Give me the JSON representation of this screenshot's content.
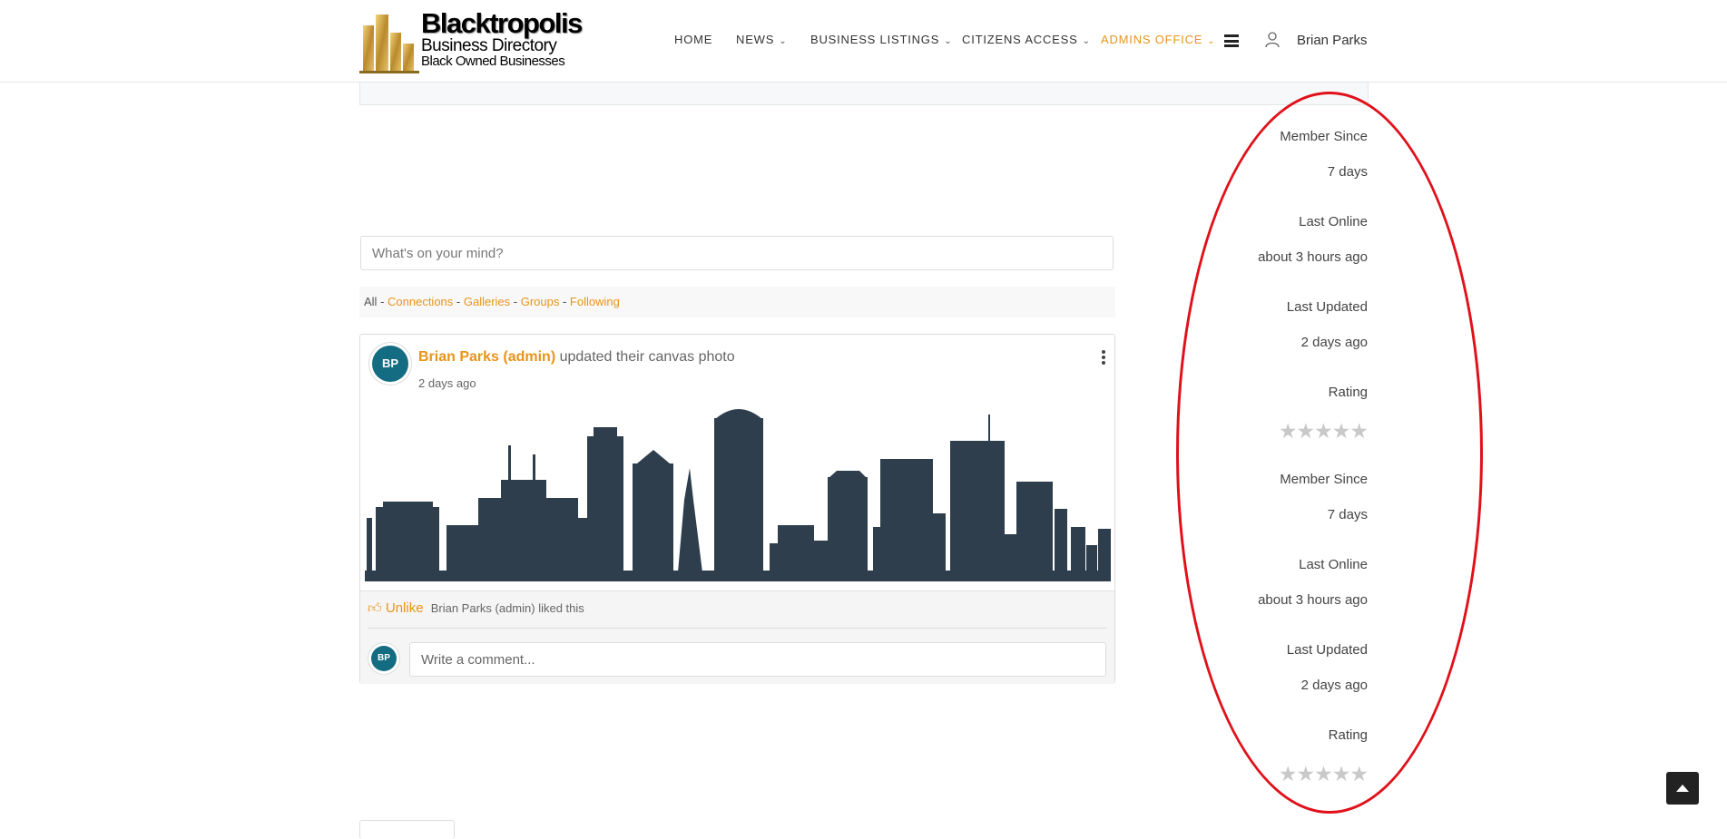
{
  "brand": {
    "title": "Blacktropolis",
    "subtitle1": "Business Directory",
    "subtitle2": "Black Owned Businesses"
  },
  "nav": {
    "items": [
      {
        "label": "HOME"
      },
      {
        "label": "NEWS"
      },
      {
        "label": "BUSINESS LISTINGS"
      },
      {
        "label": "CITIZENS ACCESS"
      },
      {
        "label": "ADMINS OFFICE"
      }
    ],
    "user_name": "Brian Parks",
    "active_color": "#e8941a"
  },
  "composer": {
    "placeholder": "What's on your mind?"
  },
  "filters": {
    "all": "All",
    "sep": " - ",
    "connections": "Connections",
    "galleries": "Galleries",
    "groups": "Groups",
    "following": "Following"
  },
  "post": {
    "avatar_initials": "BP",
    "author": "Brian Parks (admin)",
    "action": "updated their canvas photo",
    "time": "2 days ago",
    "unlike_label": "Unlike",
    "liked_text": "Brian Parks (admin) liked this",
    "comment_placeholder": "Write a comment...",
    "comment_avatar_initials": "BP",
    "skyline_color": "#2f3e4d"
  },
  "stats": {
    "block1": {
      "member_since_label": "Member Since",
      "member_since_value": "7 days",
      "last_online_label": "Last Online",
      "last_online_value": "about 3 hours ago",
      "last_updated_label": "Last Updated",
      "last_updated_value": "2 days ago",
      "rating_label": "Rating",
      "rating_value": 0,
      "rating_max": 5
    },
    "block2": {
      "member_since_label": "Member Since",
      "member_since_value": "7 days",
      "last_online_label": "Last Online",
      "last_online_value": "about 3 hours ago",
      "last_updated_label": "Last Updated",
      "last_updated_value": "2 days ago",
      "rating_label": "Rating",
      "rating_value": 0,
      "rating_max": 5
    }
  },
  "annotation_color": "#e0111a"
}
